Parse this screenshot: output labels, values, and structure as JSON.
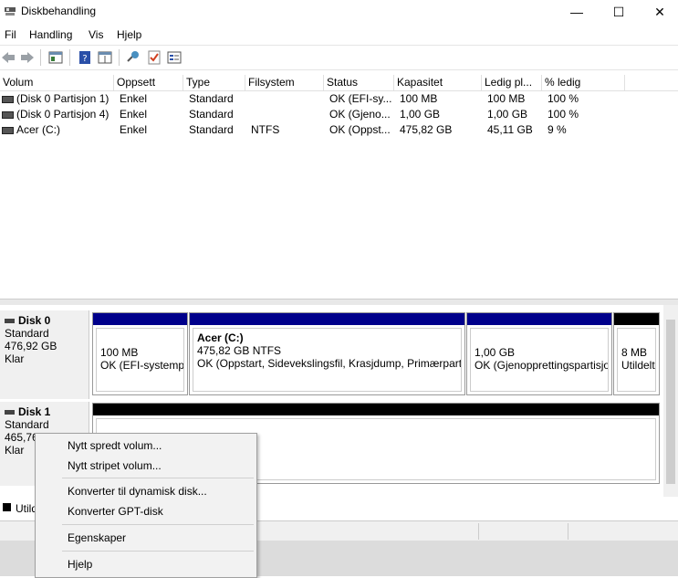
{
  "window": {
    "title": "Diskbehandling",
    "controls": {
      "minimize": "—",
      "maximize": "☐",
      "close": "✕"
    }
  },
  "menu": [
    "Fil",
    "Handling",
    "Vis",
    "Hjelp"
  ],
  "toolbar": {
    "icons": [
      "back-icon",
      "forward-icon",
      "show-hide-console-tree-icon",
      "help-icon",
      "properties-icon",
      "connect-icon",
      "check-icon",
      "settings-icon"
    ]
  },
  "volume_list": {
    "columns": [
      "Volum",
      "Oppsett",
      "Type",
      "Filsystem",
      "Status",
      "Kapasitet",
      "Ledig pl...",
      "% ledig"
    ],
    "rows": [
      {
        "volum": "(Disk 0 Partisjon 1)",
        "oppsett": "Enkel",
        "type": "Standard",
        "filsystem": "",
        "status": "OK (EFI-sy...",
        "kapasitet": "100 MB",
        "ledig": "100 MB",
        "prosent": "100 %"
      },
      {
        "volum": "(Disk 0 Partisjon 4)",
        "oppsett": "Enkel",
        "type": "Standard",
        "filsystem": "",
        "status": "OK (Gjeno...",
        "kapasitet": "1,00 GB",
        "ledig": "1,00 GB",
        "prosent": "100 %"
      },
      {
        "volum": "Acer (C:)",
        "oppsett": "Enkel",
        "type": "Standard",
        "filsystem": "NTFS",
        "status": "OK (Oppst...",
        "kapasitet": "475,82 GB",
        "ledig": "45,11 GB",
        "prosent": "9 %"
      }
    ]
  },
  "disks": [
    {
      "name": "Disk 0",
      "type": "Standard",
      "size": "476,92 GB",
      "state": "Klar",
      "partitions": [
        {
          "title": "",
          "line1": "100 MB",
          "line2": "OK (EFI-systempartisjon)"
        },
        {
          "title": "Acer  (C:)",
          "line1": "475,82 GB NTFS",
          "line2": "OK (Oppstart, Sidevekslingsfil, Krasjdump, Primærpartisjon)"
        },
        {
          "title": "",
          "line1": "1,00 GB",
          "line2": "OK (Gjenopprettingspartisjon)"
        },
        {
          "title": "",
          "line1": "8 MB",
          "line2": "Utildelt"
        }
      ]
    },
    {
      "name": "Disk 1",
      "type": "Standard",
      "size": "465,76",
      "state": "Klar"
    }
  ],
  "legend": {
    "unallocated": "Utild"
  },
  "colors": {
    "primary_bar": "#00008b",
    "unallocated_bar": "#000000"
  },
  "context_menu": {
    "items": [
      "Nytt spredt volum...",
      "Nytt stripet volum...",
      "Konverter til dynamisk disk...",
      "Konverter GPT-disk",
      "Egenskaper",
      "Hjelp"
    ]
  }
}
